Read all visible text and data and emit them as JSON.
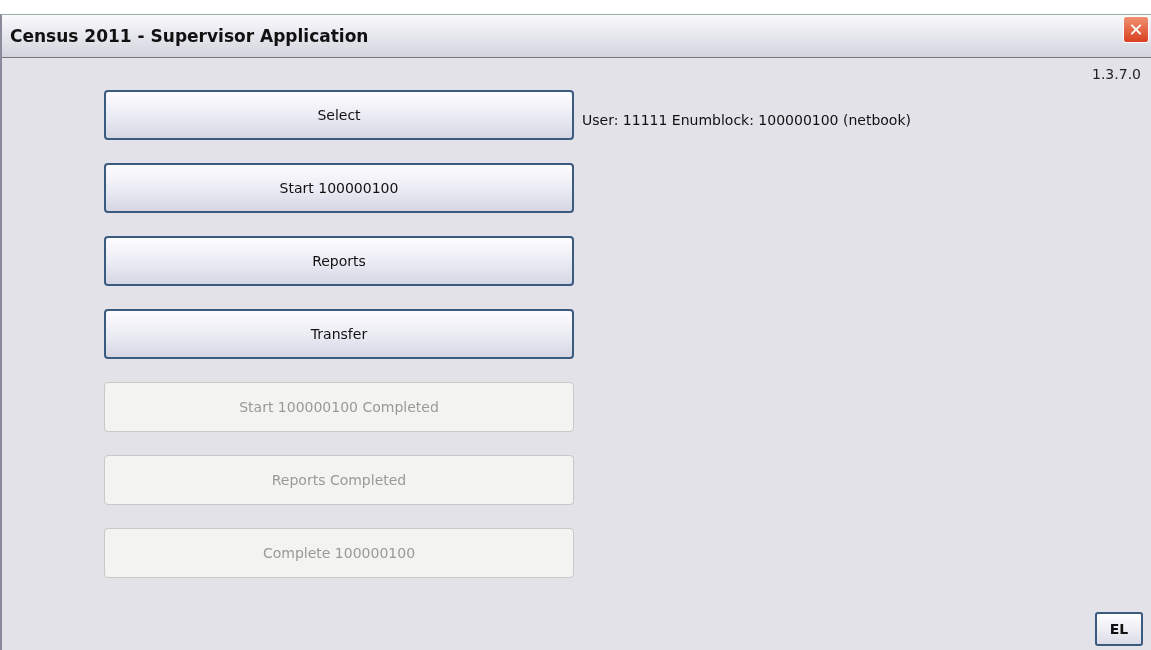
{
  "window": {
    "title": "Census 2011 - Supervisor Application",
    "close": "✕"
  },
  "version": "1.3.7.0",
  "buttons": [
    {
      "label": "Select",
      "disabled": false
    },
    {
      "label": "Start 100000100",
      "disabled": false
    },
    {
      "label": "Reports",
      "disabled": false
    },
    {
      "label": "Transfer",
      "disabled": false
    },
    {
      "label": "Start 100000100 Completed",
      "disabled": true
    },
    {
      "label": "Reports Completed",
      "disabled": true
    },
    {
      "label": "Complete 100000100",
      "disabled": true
    }
  ],
  "status": "User: 11111 Enumblock: 100000100 (netbook)",
  "language_button": "EL"
}
